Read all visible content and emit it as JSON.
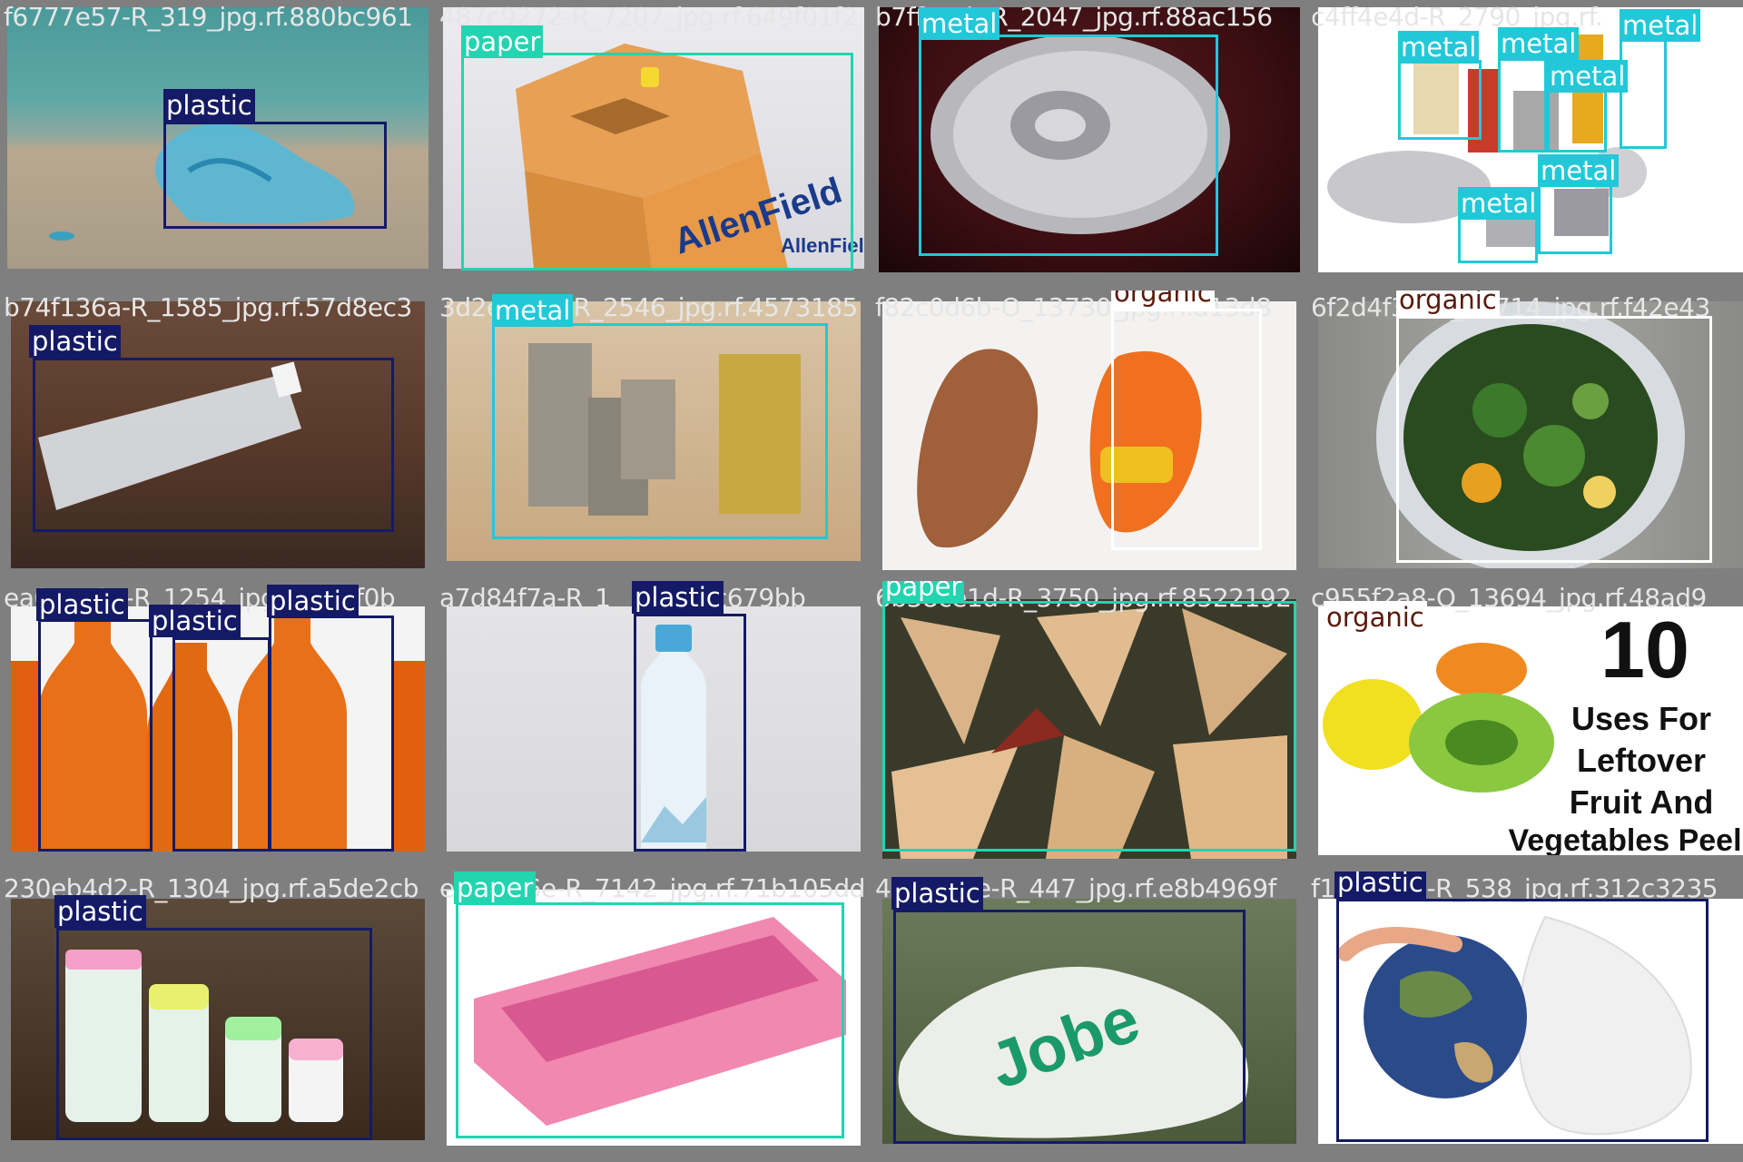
{
  "tiles": [
    {
      "file": "f6777e57-R_319_jpg.rf.880bc961",
      "labels": [
        {
          "cls": "plastic"
        }
      ]
    },
    {
      "file": "487c9272-R_7207_jpg.rf.649f01f2",
      "labels": [
        {
          "cls": "paper"
        }
      ],
      "art_text": [
        "AllenField",
        "AllenField"
      ]
    },
    {
      "file": "b7ffcc4b-R_2047_jpg.rf.88ac156",
      "labels": [
        {
          "cls": "metal"
        }
      ]
    },
    {
      "file": "c4ff4e4d-R_2790_jpg.rf.",
      "labels": [
        {
          "cls": "metal"
        },
        {
          "cls": "metal"
        },
        {
          "cls": "metal"
        },
        {
          "cls": "metal"
        },
        {
          "cls": "metal"
        },
        {
          "cls": "metal"
        }
      ]
    },
    {
      "file": "b74f136a-R_1585_jpg.rf.57d8ec3",
      "labels": [
        {
          "cls": "plastic"
        }
      ]
    },
    {
      "file": "3d2e7448-R_2546_jpg.rf.4573185",
      "labels": [
        {
          "cls": "metal"
        }
      ]
    },
    {
      "file": "f82c0d6b-O_13730_jpg.rf.a13d8",
      "labels": [
        {
          "cls": "organic"
        }
      ]
    },
    {
      "file": "6f2d4f3e-O_13714_jpg.rf.f42e43",
      "labels": [
        {
          "cls": "organic"
        }
      ]
    },
    {
      "file": "ea0c1a3a-R_1254_jpg.rf.463f0b",
      "labels": [
        {
          "cls": "plastic"
        },
        {
          "cls": "plastic"
        },
        {
          "cls": "plastic"
        }
      ]
    },
    {
      "file": "a7d84f7a-R_1__jpg.rf.fc679bb",
      "labels": [
        {
          "cls": "plastic"
        }
      ]
    },
    {
      "file": "6b38ce1d-R_3750_jpg.rf.8522192",
      "labels": [
        {
          "cls": "paper"
        }
      ]
    },
    {
      "file": "c955f2a8-O_13694_jpg.rf.48ad9",
      "labels": [
        {
          "cls": "organic"
        }
      ],
      "art_text": [
        "10",
        "Uses For",
        "Leftover",
        "Fruit And",
        "Vegetables Peel"
      ]
    },
    {
      "file": "230eb4d2-R_1304_jpg.rf.a5de2cb",
      "labels": [
        {
          "cls": "plastic"
        }
      ]
    },
    {
      "file": "e4a82f6e-R_7142_jpg.rf.71b105dd",
      "labels": [
        {
          "cls": "paper"
        }
      ]
    },
    {
      "file": "4b1c9dfe-R_447_jpg.rf.e8b4969f",
      "labels": [
        {
          "cls": "plastic"
        }
      ],
      "art_text": [
        "Jobe"
      ]
    },
    {
      "file": "f1d2e3c4-R_538_jpg.rf.312c3235",
      "labels": [
        {
          "cls": "plastic"
        }
      ]
    }
  ],
  "colors": {
    "plastic": "#141a66",
    "paper": "#22d4b0",
    "metal": "#22c8d8",
    "organic": "#ffffff",
    "background": "#7f7f7f"
  }
}
